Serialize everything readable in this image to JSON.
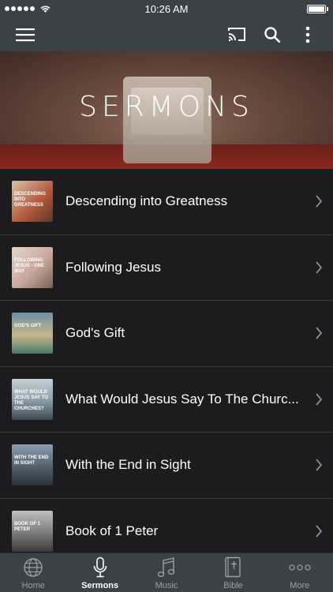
{
  "status_bar": {
    "time": "10:26 AM"
  },
  "hero": {
    "title": "SERMONS"
  },
  "sermons": [
    {
      "title": "Descending into Greatness",
      "thumb_text": "Descending into Greatness",
      "thumb_color": "#b0563a"
    },
    {
      "title": "Following Jesus",
      "thumb_text": "Following Jesus · ONE WAY",
      "thumb_color": "#c9a79a"
    },
    {
      "title": "God's Gift",
      "thumb_text": "God's Gift",
      "thumb_color": "#4a7a6a"
    },
    {
      "title": "What Would Jesus Say To The Churc...",
      "thumb_text": "What Would Jesus Say To The Churches?",
      "thumb_color": "#6a8090"
    },
    {
      "title": "With the End in Sight",
      "thumb_text": "With The End In Sight",
      "thumb_color": "#53606a"
    },
    {
      "title": "Book of 1 Peter",
      "thumb_text": "Book of 1 Peter",
      "thumb_color": "#7a7a7a"
    }
  ],
  "tabs": [
    {
      "label": "Home",
      "icon": "globe-icon"
    },
    {
      "label": "Sermons",
      "icon": "microphone-icon",
      "active": true
    },
    {
      "label": "Music",
      "icon": "music-note-icon"
    },
    {
      "label": "Bible",
      "icon": "bible-icon"
    },
    {
      "label": "More",
      "icon": "more-dots-icon"
    }
  ]
}
